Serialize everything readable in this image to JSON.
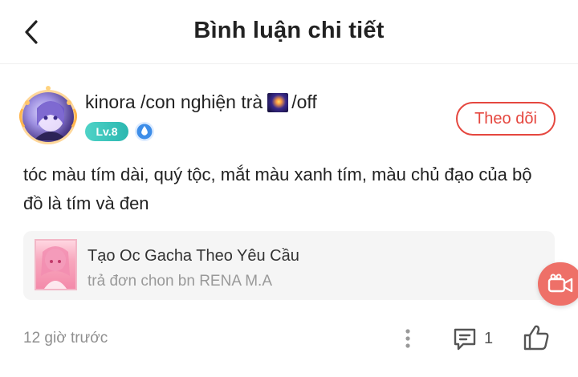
{
  "header": {
    "title": "Bình luận chi tiết",
    "back_icon": "chevron-left-icon"
  },
  "user": {
    "name_part1": "kinora /con nghiện trà",
    "name_part2": "/off",
    "level": "Lv.8",
    "rank_icon": "water-drop-badge-icon"
  },
  "follow_button": {
    "label": "Theo dõi",
    "color": "#e5473f"
  },
  "comment": {
    "text": "tóc màu tím dài, quý tộc, mắt màu xanh tím, màu chủ đạo của bộ đồ là tím và đen"
  },
  "linked_post": {
    "title": "Tạo Oc Gacha Theo Yêu Cầu",
    "subtitle": "trả đơn chon bn RENA M.A"
  },
  "floating_button": {
    "icon": "video-camera-icon",
    "color": "#ee7068"
  },
  "footer": {
    "timestamp": "12 giờ trước",
    "reply_count": "1",
    "more_icon": "more-vertical-icon",
    "reply_icon": "comment-icon",
    "like_icon": "thumbs-up-icon"
  }
}
